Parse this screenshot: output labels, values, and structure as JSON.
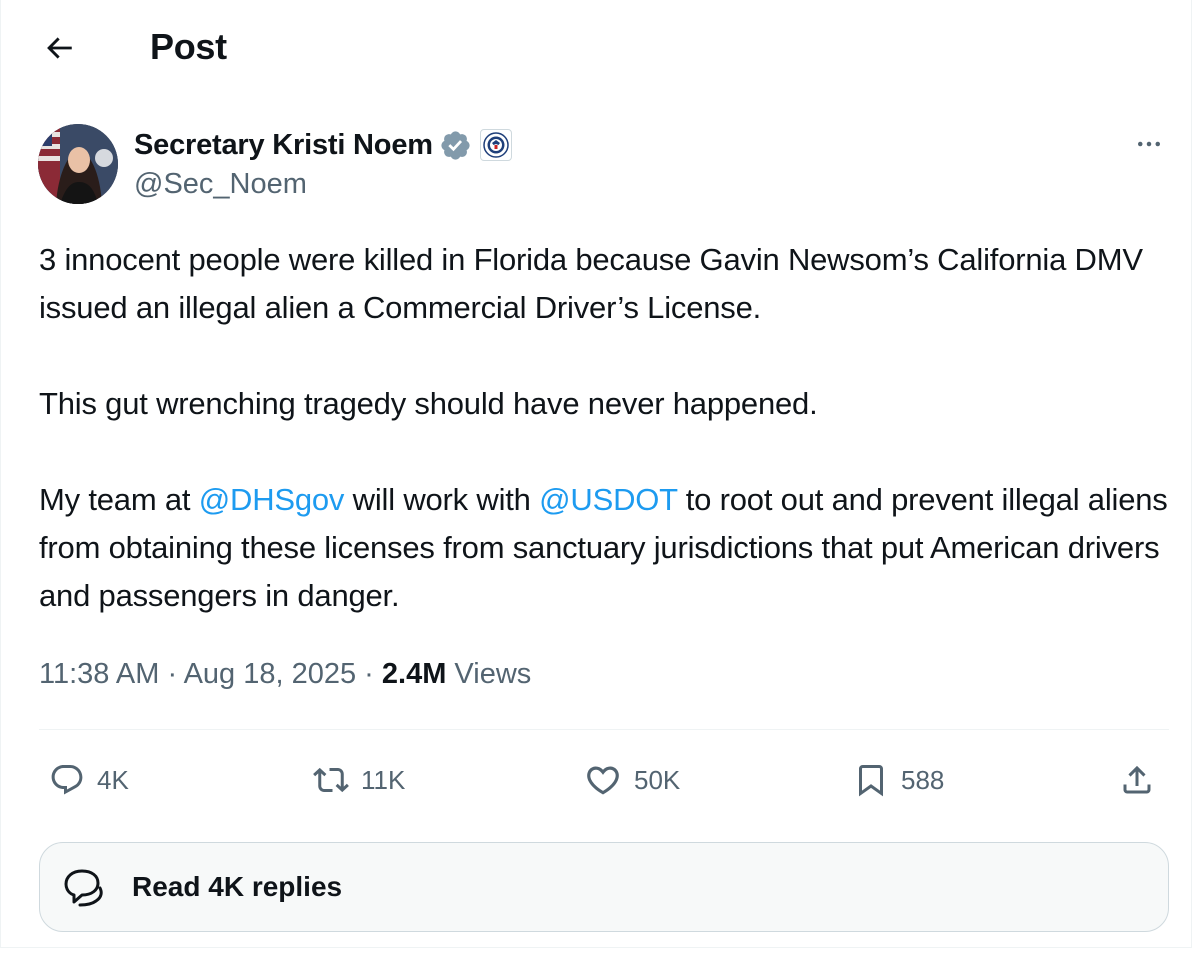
{
  "header": {
    "title": "Post"
  },
  "author": {
    "name": "Secretary Kristi Noem",
    "handle": "@Sec_Noem",
    "verified_color": "#829aab"
  },
  "tweet": {
    "paragraph1": "3 innocent people were killed in Florida because Gavin Newsom’s California DMV issued an illegal alien a Commercial Driver’s License.",
    "paragraph2": "This gut wrenching tragedy should have never happened.",
    "paragraph3": {
      "part1": "My team at ",
      "mention1": "@DHSgov",
      "part2": " will work with ",
      "mention2": "@USDOT",
      "part3": " to root out and prevent illegal aliens from obtaining these licenses from sanctuary jurisdictions that put American drivers and passengers in danger."
    }
  },
  "meta": {
    "time": "11:38 AM",
    "separator": " · ",
    "date": "Aug 18, 2025",
    "views_count": "2.4M",
    "views_label": " Views"
  },
  "actions": {
    "replies": "4K",
    "reposts": "11K",
    "likes": "50K",
    "bookmarks": "588"
  },
  "read_replies": {
    "label": "Read 4K replies"
  },
  "colors": {
    "text": "#0f1419",
    "secondary": "#536471",
    "accent": "#1d9bf0",
    "border": "#eff3f4"
  },
  "icons": [
    "arrow-left-icon",
    "verified-badge-icon",
    "dhs-seal-icon",
    "more-icon",
    "reply-icon",
    "repost-icon",
    "like-icon",
    "bookmark-icon",
    "share-icon",
    "replies-bubble-icon"
  ]
}
